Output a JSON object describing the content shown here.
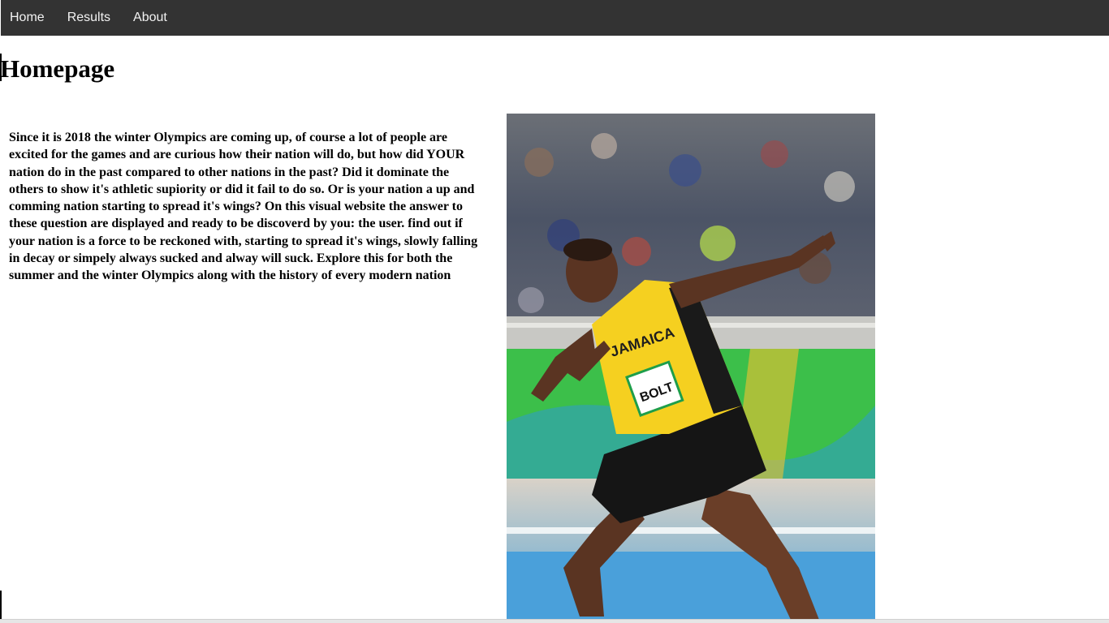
{
  "nav": {
    "items": [
      {
        "label": "Home"
      },
      {
        "label": "Results"
      },
      {
        "label": "About"
      }
    ]
  },
  "page": {
    "title": "Homepage",
    "intro": "Since it is 2018 the winter Olympics are coming up, of course a lot of people are excited for the games and are curious how their nation will do, but how did YOUR nation do in the past compared to other nations in the past? Did it dominate the others to show it's athletic supiority or did it fail to do so. Or is your nation a up and comming nation starting to spread it's wings? On this visual website the answer to these question are displayed and ready to be discoverd by you: the user. find out if your nation is a force to be reckoned with, starting to spread it's wings, slowly falling in decay or simpely always sucked and alway will suck. Explore this for both the summer and the winter Olympics along with the history of every modern nation"
  },
  "hero_image": {
    "jersey_text": "JAMAICA",
    "bib_text": "BOLT"
  },
  "colors": {
    "nav_bg": "#333333",
    "nav_text": "#f2f2f2",
    "jersey_yellow": "#f5d020",
    "jersey_green": "#1e9e4a",
    "track_green": "#3cbf4a"
  }
}
